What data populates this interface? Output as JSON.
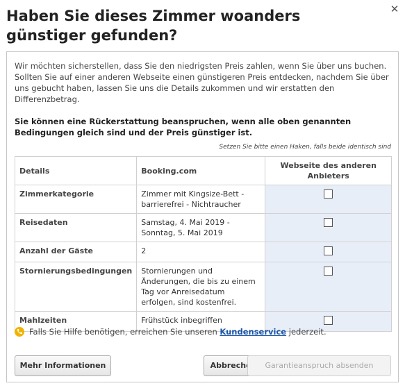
{
  "dialog": {
    "title": "Haben Sie dieses Zimmer woanders günstiger gefunden?",
    "close_symbol": "✕"
  },
  "intro": "Wir möchten sicherstellen, dass Sie den niedrigsten Preis zahlen, wenn Sie über uns buchen. Sollten Sie auf einer anderen Webseite einen günstigeren Preis entdecken, nachdem Sie über uns gebucht haben, lassen Sie uns die Details zukommen und wir erstatten den Differenzbetrag.",
  "claim": "Sie können eine Rückerstattung beanspruchen, wenn alle oben genannten Bedingungen gleich sind und der Preis günstiger ist.",
  "note": "Setzen Sie bitte einen Haken, falls beide identisch sind",
  "table": {
    "headers": [
      "Details",
      "Booking.com",
      "Webseite des anderen Anbieters"
    ],
    "rows": [
      {
        "label": "Zimmerkategorie",
        "value": "Zimmer mit Kingsize-Bett - barrierefrei - Nichtraucher",
        "checked": false
      },
      {
        "label": "Reisedaten",
        "value": "Samstag, 4. Mai 2019 - Sonntag, 5. Mai 2019",
        "checked": false
      },
      {
        "label": "Anzahl der Gäste",
        "value": "2",
        "checked": false
      },
      {
        "label": "Stornierungsbedingungen",
        "value": "Stornierungen und Änderungen, die bis zu einem Tag vor Anreisedatum erfolgen, sind kostenfrei.",
        "checked": false
      },
      {
        "label": "Mahlzeiten",
        "value": "Frühstück inbegriffen",
        "checked": false
      }
    ]
  },
  "help": {
    "prefix": "Falls Sie Hilfe benötigen, erreichen Sie unseren",
    "link": "Kundenservice",
    "suffix": "jederzeit.",
    "icon": "phone-icon",
    "icon_color": "#f0b400"
  },
  "buttons": {
    "more": "Mehr Informationen",
    "cancel": "Abbrechen",
    "submit": "Garantieanspruch absenden"
  },
  "colors": {
    "link": "#1a56a6",
    "highlight_column": "#e8eef8"
  }
}
